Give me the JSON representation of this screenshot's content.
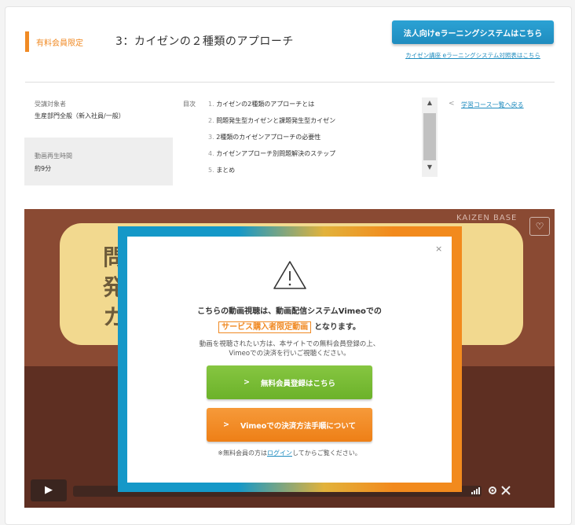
{
  "header": {
    "badge": "有料会員限定",
    "title": "3：カイゼンの２種類のアプローチ",
    "corporate_button": "法人向けeラーニングシステムはこちら",
    "compare_link": "カイゼン講座 eラーニングシステム対照表はこちら"
  },
  "info": {
    "target_label": "受講対象者",
    "target_value": "生産部門全般（新入社員/一般）",
    "duration_label": "動画再生時間",
    "duration_value": "約9分"
  },
  "toc": {
    "label": "目次",
    "items": [
      {
        "num": "1.",
        "text": "カイゼンの2種類のアプローチとは"
      },
      {
        "num": "2.",
        "text": "問題発生型カイゼンと課題発生型カイゼン"
      },
      {
        "num": "3.",
        "text": "2種類のカイゼンアプローチの必要性"
      },
      {
        "num": "4.",
        "text": "カイゼンアプローチ別問題解決のステップ"
      },
      {
        "num": "5.",
        "text": "まとめ"
      }
    ]
  },
  "back_link": {
    "arrow": "<",
    "label": "学習コース一覧へ戻る"
  },
  "video": {
    "logo": "KAIZEN BASE",
    "bg_text_1": "問",
    "bg_text_2": "発",
    "bg_text_3": "カ",
    "heart": "♡",
    "play": "▶"
  },
  "modal": {
    "close": "×",
    "line1": "こちらの動画視聴は、動画配信システムVimeoでの",
    "tag": "サービス購入者限定動画",
    "line2_suffix": "となります。",
    "desc1": "動画を視聴されたい方は、本サイトでの無料会員登録の上、",
    "desc2": "Vimeoでの決済を行いご視聴ください。",
    "register_button": "無料会員登録はこちら",
    "payment_button": "Vimeoでの決済方法手順について",
    "chevron": ">",
    "note_prefix": "※無料会員の方は",
    "note_link": "ログイン",
    "note_suffix": "してからご覧ください。"
  },
  "colors": {
    "accent_orange": "#f08a24",
    "link_blue": "#1f8cbf",
    "green": "#6cb22a"
  }
}
